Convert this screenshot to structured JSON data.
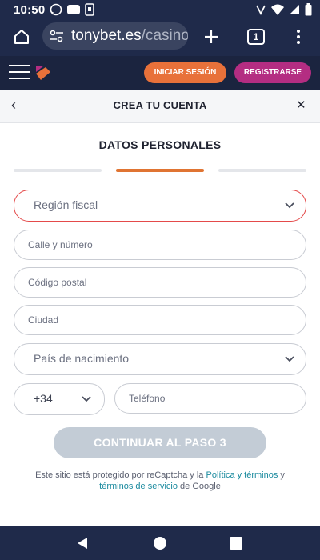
{
  "status_bar": {
    "time": "10:50",
    "left_icons": [
      "whatsapp-icon",
      "app-icon",
      "sim-icon"
    ],
    "right_icons": [
      "cast-icon",
      "wifi-icon",
      "signal-icon",
      "battery-icon"
    ]
  },
  "browser": {
    "url_main": "tonybet.es",
    "url_faint": "/casino",
    "tab_count": "1"
  },
  "site_header": {
    "login_label": "INICIAR SESIÓN",
    "register_label": "REGISTRARSE",
    "colors": {
      "login": "#e8713a",
      "register": "#b42d82",
      "header_bg": "#1b243f"
    }
  },
  "modal": {
    "title": "CREA TU CUENTA",
    "section_title": "DATOS PERSONALES",
    "progress": {
      "total_steps": 3,
      "current_step": 2,
      "active_color": "#e07432"
    }
  },
  "form": {
    "region_placeholder": "Región fiscal",
    "street_placeholder": "Calle y número",
    "postal_placeholder": "Código postal",
    "city_placeholder": "Ciudad",
    "birth_country_placeholder": "País de nacimiento",
    "phone_prefix": "+34",
    "phone_placeholder": "Teléfono",
    "continue_label": "CONTINUAR AL PASO 3"
  },
  "recaptcha": {
    "text_before": "Este sitio está protegido por reCaptcha y la ",
    "policy_link": "Política y términos",
    "text_mid": " y ",
    "terms_link": "términos de servicio",
    "text_after": " de Google"
  }
}
